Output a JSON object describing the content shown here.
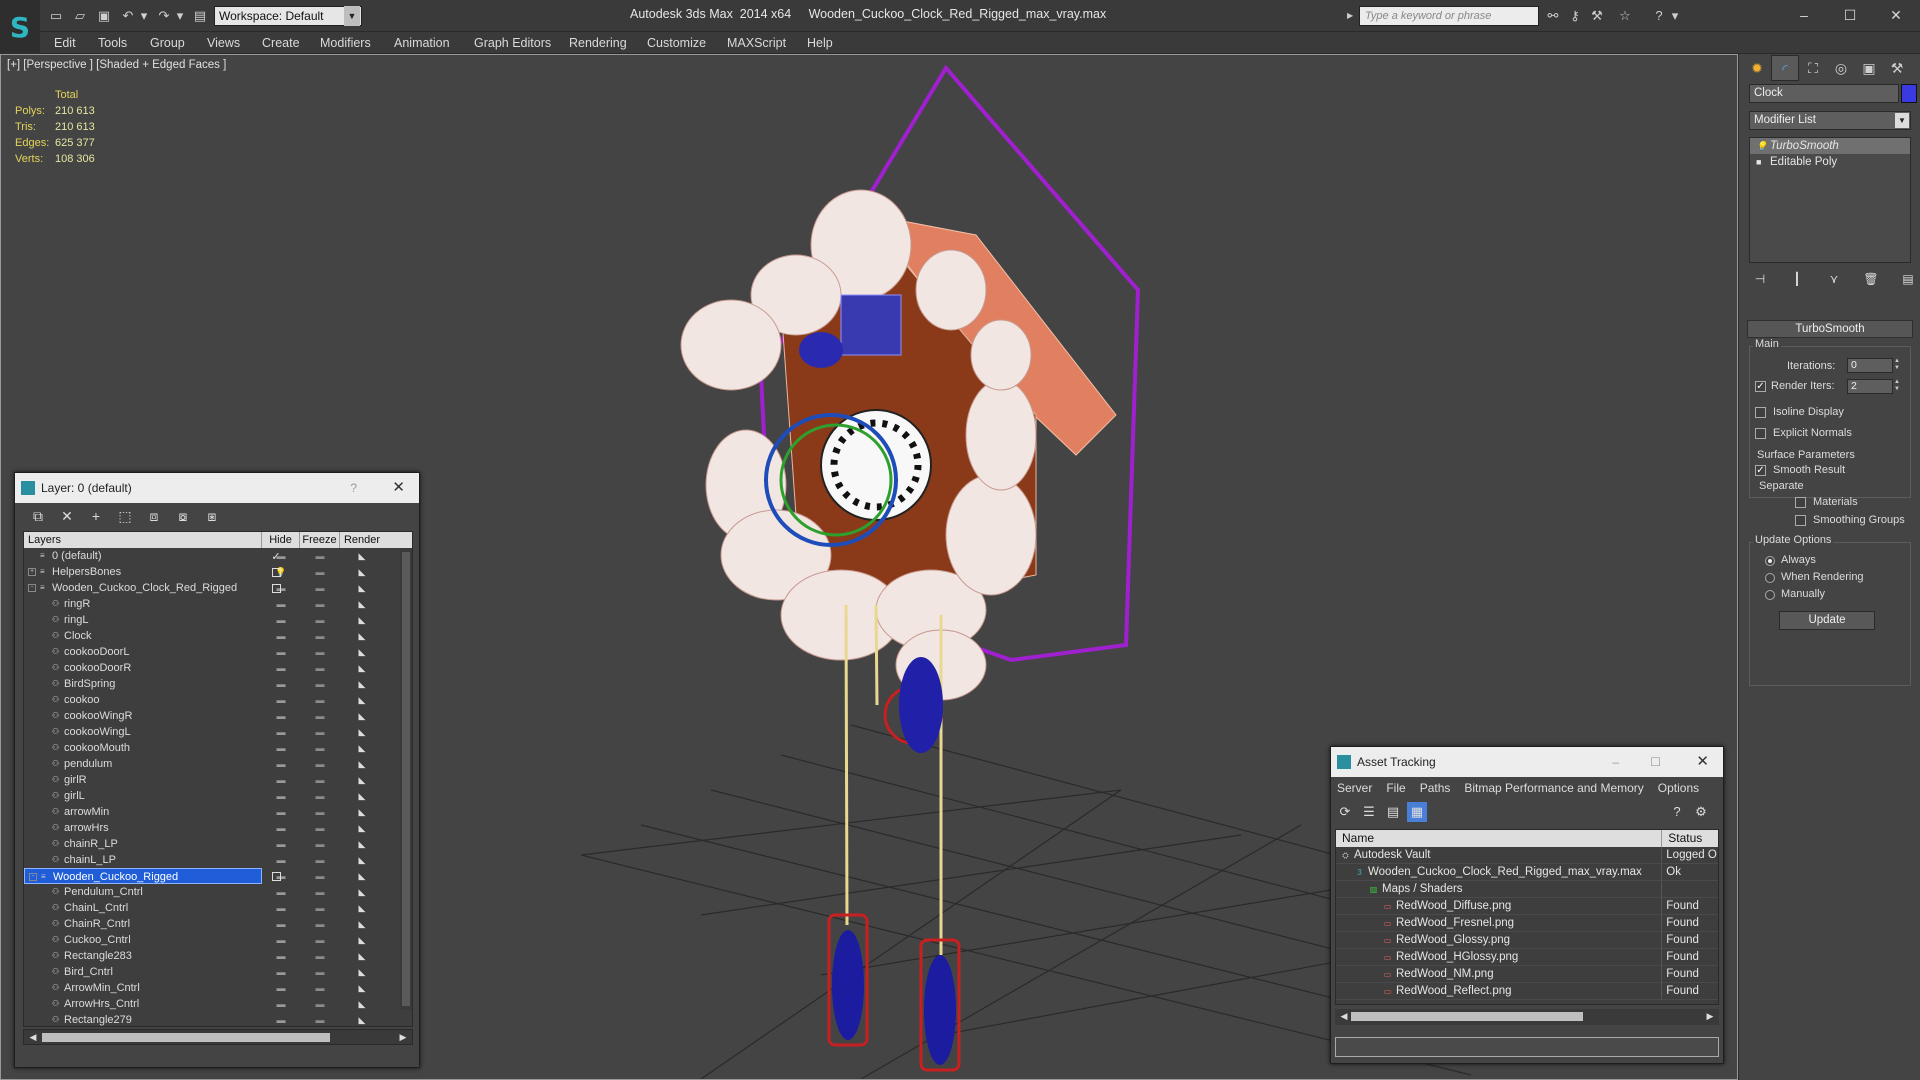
{
  "app": {
    "title": "Autodesk 3ds Max  2014 x64     Wooden_Cuckoo_Clock_Red_Rigged_max_vray.max",
    "workspace": "Workspace: Default",
    "search_placeholder": "Type a keyword or phrase"
  },
  "menu": [
    "Edit",
    "Tools",
    "Group",
    "Views",
    "Create",
    "Modifiers",
    "Animation",
    "Graph Editors",
    "Rendering",
    "Customize",
    "MAXScript",
    "Help"
  ],
  "viewport": {
    "label": "[+] [Perspective ] [Shaded + Edged Faces ]",
    "stats": {
      "header": "Total",
      "rows": [
        {
          "k": "Polys:",
          "v": "210 613"
        },
        {
          "k": "Tris:",
          "v": "210 613"
        },
        {
          "k": "Edges:",
          "v": "625 377"
        },
        {
          "k": "Verts:",
          "v": "108 306"
        }
      ]
    }
  },
  "command_panel": {
    "object_name": "Clock",
    "object_color": "#3a3ae0",
    "modifier_list": "Modifier List",
    "stack": [
      "TurboSmooth",
      "Editable Poly"
    ],
    "turbosmooth": {
      "title": "TurboSmooth",
      "main": "Main",
      "iterations_label": "Iterations:",
      "iterations_value": "0",
      "render_iters_label": "Render Iters:",
      "render_iters_value": "2",
      "isoline": "Isoline Display",
      "explicit_normals": "Explicit Normals",
      "surface_params": "Surface Parameters",
      "smooth_result": "Smooth Result",
      "separate": "Separate",
      "materials": "Materials",
      "smoothing_groups": "Smoothing Groups",
      "update_options": "Update Options",
      "always": "Always",
      "when_rendering": "When Rendering",
      "manually": "Manually",
      "update": "Update"
    }
  },
  "layer_dialog": {
    "title": "Layer: 0 (default)",
    "help": "?",
    "columns": [
      "Layers",
      "Hide",
      "Freeze",
      "Render"
    ],
    "rows": [
      {
        "name": "0 (default)",
        "indent": 0,
        "toggle": "",
        "current": "check"
      },
      {
        "name": "HelpersBones",
        "indent": 0,
        "toggle": "+",
        "current": "box",
        "bulb": true
      },
      {
        "name": "Wooden_Cuckoo_Clock_Red_Rigged",
        "indent": 0,
        "toggle": "-",
        "current": "box"
      },
      {
        "name": "ringR",
        "indent": 1
      },
      {
        "name": "ringL",
        "indent": 1
      },
      {
        "name": "Clock",
        "indent": 1
      },
      {
        "name": "cookooDoorL",
        "indent": 1
      },
      {
        "name": "cookooDoorR",
        "indent": 1
      },
      {
        "name": "BirdSpring",
        "indent": 1
      },
      {
        "name": "cookoo",
        "indent": 1
      },
      {
        "name": "cookooWingR",
        "indent": 1
      },
      {
        "name": "cookooWingL",
        "indent": 1
      },
      {
        "name": "cookooMouth",
        "indent": 1
      },
      {
        "name": "pendulum",
        "indent": 1
      },
      {
        "name": "girlR",
        "indent": 1
      },
      {
        "name": "girlL",
        "indent": 1
      },
      {
        "name": "arrowMin",
        "indent": 1
      },
      {
        "name": "arrowHrs",
        "indent": 1
      },
      {
        "name": "chainR_LP",
        "indent": 1
      },
      {
        "name": "chainL_LP",
        "indent": 1
      },
      {
        "name": "Wooden_Cuckoo_Rigged",
        "indent": 0,
        "toggle": "-",
        "current": "box",
        "selected": true
      },
      {
        "name": "Pendulum_Cntrl",
        "indent": 1
      },
      {
        "name": "ChainL_Cntrl",
        "indent": 1
      },
      {
        "name": "ChainR_Cntrl",
        "indent": 1
      },
      {
        "name": "Cuckoo_Cntrl",
        "indent": 1
      },
      {
        "name": "Rectangle283",
        "indent": 1
      },
      {
        "name": "Bird_Cntrl",
        "indent": 1
      },
      {
        "name": "ArrowMin_Cntrl",
        "indent": 1
      },
      {
        "name": "ArrowHrs_Cntrl",
        "indent": 1
      },
      {
        "name": "Rectangle279",
        "indent": 1
      }
    ]
  },
  "asset_dialog": {
    "title": "Asset Tracking",
    "menu": [
      "Server",
      "File",
      "Paths",
      "Bitmap Performance and Memory",
      "Options"
    ],
    "columns": [
      "Name",
      "Status"
    ],
    "rows": [
      {
        "name": "Autodesk Vault",
        "status": "Logged O",
        "indent": 1,
        "icon": "vault"
      },
      {
        "name": "Wooden_Cuckoo_Clock_Red_Rigged_max_vray.max",
        "status": "Ok",
        "indent": 2,
        "icon": "max"
      },
      {
        "name": "Maps / Shaders",
        "status": "",
        "indent": 3,
        "icon": "maps"
      },
      {
        "name": "RedWood_Diffuse.png",
        "status": "Found",
        "indent": 4,
        "icon": "png"
      },
      {
        "name": "RedWood_Fresnel.png",
        "status": "Found",
        "indent": 4,
        "icon": "png"
      },
      {
        "name": "RedWood_Glossy.png",
        "status": "Found",
        "indent": 4,
        "icon": "png"
      },
      {
        "name": "RedWood_HGlossy.png",
        "status": "Found",
        "indent": 4,
        "icon": "png"
      },
      {
        "name": "RedWood_NM.png",
        "status": "Found",
        "indent": 4,
        "icon": "png"
      },
      {
        "name": "RedWood_Reflect.png",
        "status": "Found",
        "indent": 4,
        "icon": "png"
      }
    ]
  }
}
